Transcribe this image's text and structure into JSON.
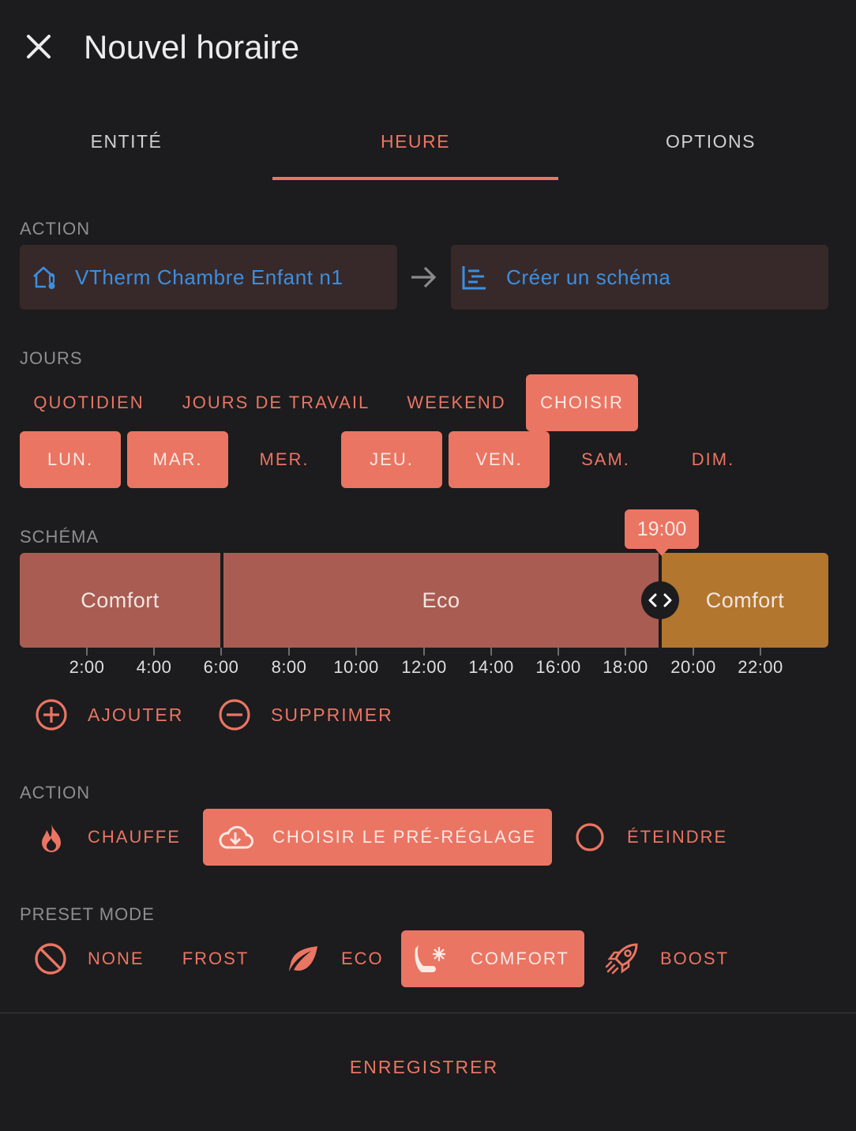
{
  "header": {
    "title": "Nouvel horaire"
  },
  "tabs": [
    {
      "label": "ENTITÉ"
    },
    {
      "label": "HEURE",
      "active": true
    },
    {
      "label": "OPTIONS"
    }
  ],
  "action_section": {
    "label": "ACTION",
    "entity": "VTherm Chambre Enfant n1",
    "target": "Créer un schéma"
  },
  "days_section": {
    "label": "JOURS",
    "presets": [
      {
        "label": "QUOTIDIEN",
        "selected": false
      },
      {
        "label": "JOURS DE TRAVAIL",
        "selected": false
      },
      {
        "label": "WEEKEND",
        "selected": false
      },
      {
        "label": "CHOISIR",
        "selected": true
      }
    ],
    "days": [
      {
        "label": "LUN.",
        "selected": true
      },
      {
        "label": "MAR.",
        "selected": true
      },
      {
        "label": "MER.",
        "selected": false
      },
      {
        "label": "JEU.",
        "selected": true
      },
      {
        "label": "VEN.",
        "selected": true
      },
      {
        "label": "SAM.",
        "selected": false
      },
      {
        "label": "DIM.",
        "selected": false
      }
    ]
  },
  "schedule": {
    "label": "SCHÉMA",
    "segments": [
      {
        "label": "Comfort",
        "start": "0:00",
        "end": "6:00",
        "color": "#a95c52"
      },
      {
        "label": "Eco",
        "start": "6:00",
        "end": "19:00",
        "color": "#a95c52"
      },
      {
        "label": "Comfort",
        "start": "19:00",
        "end": "24:00",
        "color": "#b2762e"
      }
    ],
    "marker": "19:00",
    "ticks": [
      "2:00",
      "4:00",
      "6:00",
      "8:00",
      "10:00",
      "12:00",
      "14:00",
      "16:00",
      "18:00",
      "20:00",
      "22:00"
    ],
    "add_label": "AJOUTER",
    "remove_label": "SUPPRIMER"
  },
  "action2": {
    "label": "ACTION",
    "options": [
      {
        "label": "CHAUFFE",
        "icon": "fire-icon",
        "selected": false
      },
      {
        "label": "CHOISIR LE PRÉ-RÉGLAGE",
        "icon": "cloud-download-icon",
        "selected": true
      },
      {
        "label": "ÉTEINDRE",
        "icon": "circle-outline-icon",
        "selected": false
      }
    ]
  },
  "preset_mode": {
    "label": "PRESET MODE",
    "options": [
      {
        "label": "NONE",
        "icon": "cancel-icon",
        "selected": false
      },
      {
        "label": "FROST",
        "icon": "",
        "selected": false
      },
      {
        "label": "ECO",
        "icon": "leaf-icon",
        "selected": false
      },
      {
        "label": "COMFORT",
        "icon": "seat-snowflake-icon",
        "selected": true
      },
      {
        "label": "BOOST",
        "icon": "rocket-icon",
        "selected": false
      }
    ]
  },
  "footer": {
    "save_label": "ENREGISTRER"
  },
  "colors": {
    "accent": "#ea7563",
    "background": "#1c1b1d",
    "link": "#3b8fe0"
  }
}
